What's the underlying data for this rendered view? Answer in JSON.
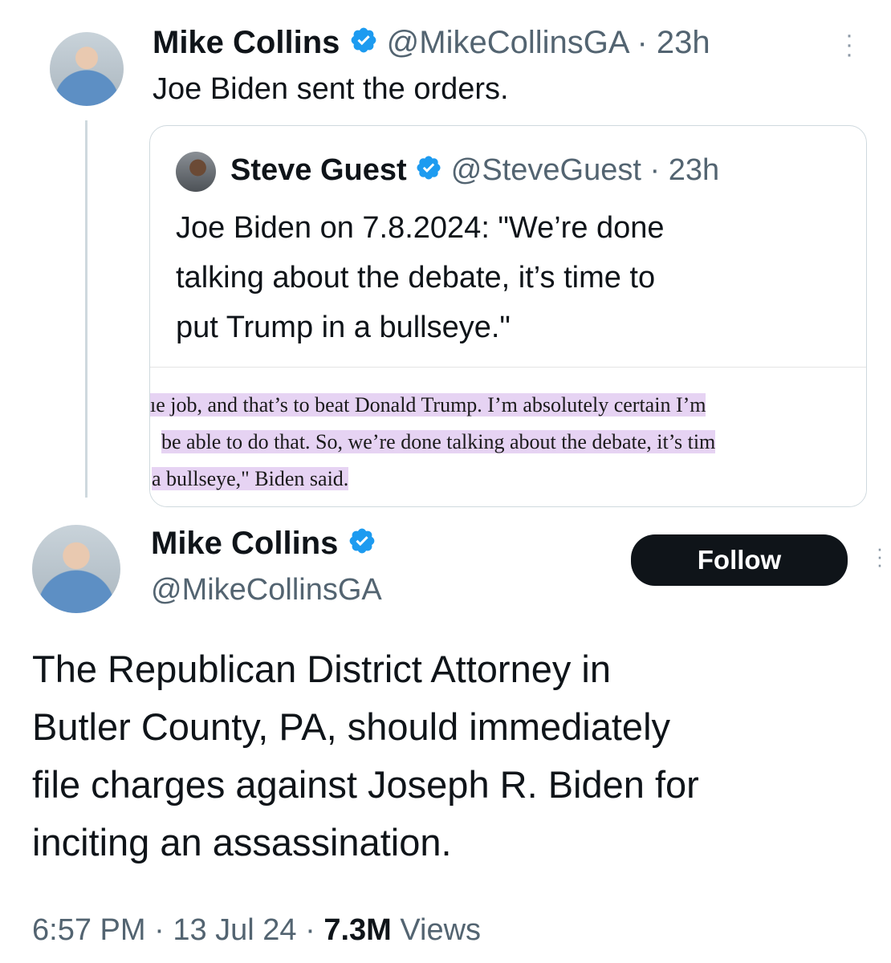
{
  "top_tweet": {
    "author_name": "Mike Collins",
    "author_handle": "@MikeCollinsGA",
    "separator": "·",
    "time": "23h",
    "text": "Joe Biden sent the orders."
  },
  "quoted_tweet": {
    "author_name": "Steve Guest",
    "author_handle": "@SteveGuest",
    "separator": "·",
    "time": "23h",
    "text_lines": [
      "Joe Biden on 7.8.2024: \"We’re done",
      "talking about the debate, it’s time to",
      "put Trump in a bullseye.\""
    ],
    "article_lines": [
      "ıe job, and that’s to beat Donald Trump. I’m absolutely certain I’m",
      "be able to do that. So, we’re done talking about the debate, it’s tim",
      "a bullseye,\" Biden said."
    ]
  },
  "main_tweet": {
    "author_name": "Mike Collins",
    "author_handle": "@MikeCollinsGA",
    "follow_label": "Follow",
    "text_lines": [
      "The Republican District Attorney in",
      "Butler County, PA, should immediately",
      "file charges against Joseph R. Biden for",
      "inciting an assassination."
    ],
    "time": "6:57 PM",
    "date": "13 Jul 24",
    "separator": "·",
    "views_count": "7.3M",
    "views_label": "Views"
  },
  "icons": {
    "verified": "verified-badge-icon",
    "more": "more-vertical-icon"
  },
  "colors": {
    "verified": "#1d9bf0",
    "text": "#0f1419",
    "secondary": "#536471",
    "highlight": "#e6d3f3"
  }
}
